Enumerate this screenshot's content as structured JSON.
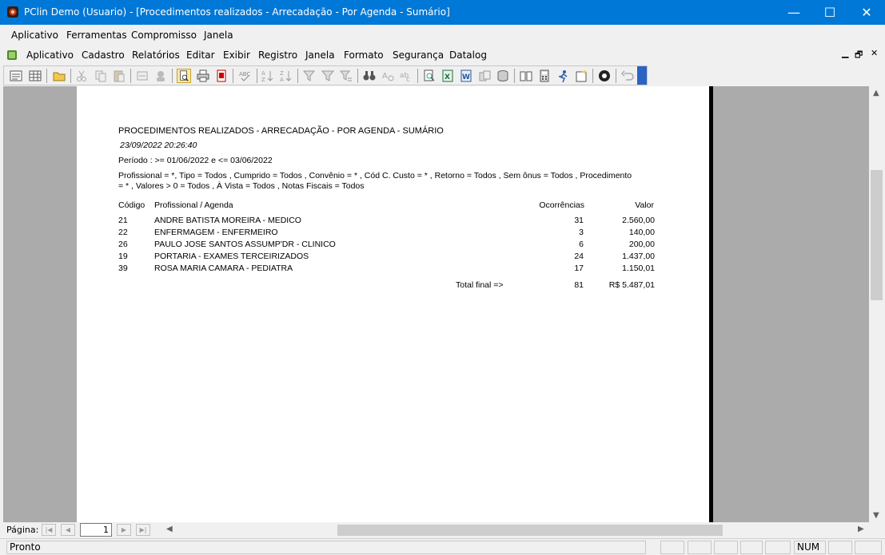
{
  "window": {
    "title": "PClin Demo (Usuario) - [Procedimentos realizados - Arrecadação - Por Agenda - Sumário]",
    "minimize": "—",
    "maximize": "☐",
    "close": "✕"
  },
  "menubar1": [
    {
      "label": "Aplicativo"
    },
    {
      "label": "Ferramentas"
    },
    {
      "label": "Compromisso"
    },
    {
      "label": "Janela"
    }
  ],
  "menubar2": [
    {
      "label": "Aplicativo"
    },
    {
      "label": "Cadastro"
    },
    {
      "label": "Relatórios"
    },
    {
      "label": "Editar"
    },
    {
      "label": "Exibir"
    },
    {
      "label": "Registro"
    },
    {
      "label": "Janela"
    },
    {
      "label": "Formato"
    },
    {
      "label": "Segurança"
    },
    {
      "label": "Datalog"
    }
  ],
  "mdi_controls": {
    "minimize": "▁",
    "restore": "🗗",
    "close": "✕"
  },
  "report": {
    "title": "PROCEDIMENTOS  REALIZADOS  -  ARRECADAÇÃO  -  POR  AGENDA  - SUMÁRIO",
    "datetime": "23/09/2022 20:26:40",
    "period": "Período :  >= 01/06/2022 e <= 03/06/2022",
    "filters_line1": "Profissional = *, Tipo = Todos , Cumprido = Todos , Convênio = * , Cód C. Custo = * , Retorno = Todos , Sem ônus = Todos , Procedimento",
    "filters_line2": "= * , Valores > 0 = Todos , À Vista = Todos , Notas Fiscais = Todos",
    "headers": {
      "code": "Código",
      "professional": "Profissional / Agenda",
      "occurrences": "Ocorrências",
      "value": "Valor"
    },
    "rows": [
      {
        "code": "21",
        "name": "ANDRE BATISTA MOREIRA   - MEDICO",
        "occ": "31",
        "value": "2.560,00"
      },
      {
        "code": "22",
        "name": "ENFERMAGEM   - ENFERMEIRO",
        "occ": "3",
        "value": "140,00"
      },
      {
        "code": "26",
        "name": "PAULO JOSE SANTOS ASSUMP'DR   - CLINICO",
        "occ": "6",
        "value": "200,00"
      },
      {
        "code": "19",
        "name": "PORTARIA   - EXAMES TERCEIRIZADOS",
        "occ": "24",
        "value": "1.437,00"
      },
      {
        "code": "39",
        "name": "ROSA MARIA CAMARA   - PEDIATRA",
        "occ": "17",
        "value": "1.150,01"
      }
    ],
    "total_label": "Total final  =>",
    "total_occ": "81",
    "total_value": "R$ 5.487,01"
  },
  "pager": {
    "label": "Página:",
    "page": "1"
  },
  "status": {
    "text": "Pronto",
    "num": "NUM"
  }
}
